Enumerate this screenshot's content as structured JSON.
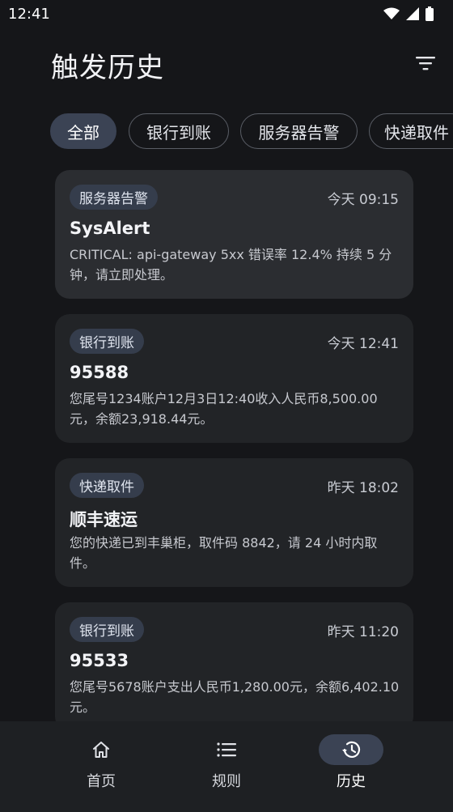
{
  "status_bar": {
    "time": "12:41"
  },
  "header": {
    "title": "触发历史"
  },
  "filters": [
    {
      "label": "全部",
      "active": true
    },
    {
      "label": "银行到账",
      "active": false
    },
    {
      "label": "服务器告警",
      "active": false
    },
    {
      "label": "快递取件",
      "active": false
    }
  ],
  "history": [
    {
      "tag": "服务器告警",
      "time": "今天 09:15",
      "sender": "SysAlert",
      "body": "CRITICAL: api-gateway 5xx 错误率 12.4% 持续 5 分钟，请立即处理。"
    },
    {
      "tag": "银行到账",
      "time": "今天 12:41",
      "sender": "95588",
      "body": "您尾号1234账户12月3日12:40收入人民币8,500.00元，余额23,918.44元。"
    },
    {
      "tag": "快递取件",
      "time": "昨天 18:02",
      "sender": "顺丰速运",
      "body": "您的快递已到丰巢柜，取件码 8842，请 24 小时内取件。"
    },
    {
      "tag": "银行到账",
      "time": "昨天 11:20",
      "sender": "95533",
      "body": "您尾号5678账户支出人民币1,280.00元，余额6,402.10元。"
    }
  ],
  "bottom_nav": [
    {
      "label": "首页",
      "icon": "home-icon",
      "active": false
    },
    {
      "label": "规则",
      "icon": "list-icon",
      "active": false
    },
    {
      "label": "历史",
      "icon": "history-icon",
      "active": true
    }
  ],
  "colors": {
    "background": "#151619",
    "card": "#222427",
    "accent_container": "#3b4354",
    "tag_background": "#353d4c"
  }
}
